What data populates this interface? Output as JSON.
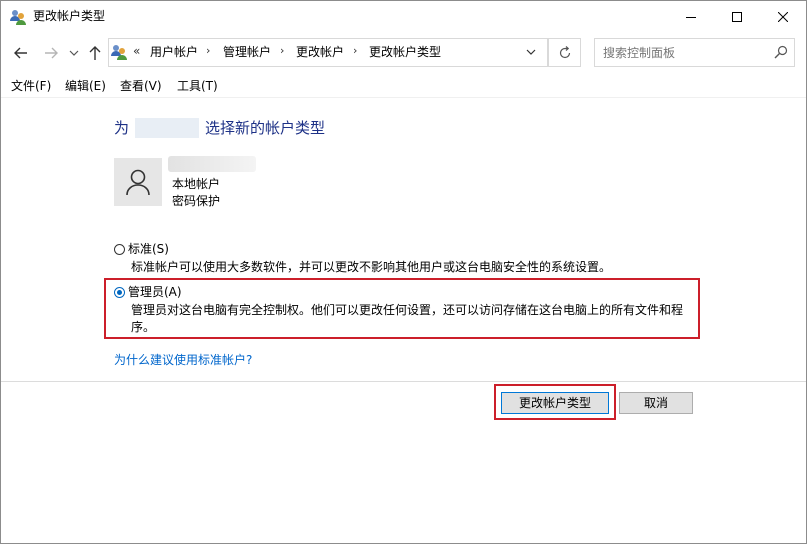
{
  "window": {
    "title": "更改帐户类型"
  },
  "address_bar": {
    "overflow": "«",
    "breadcrumbs": [
      "用户帐户",
      "管理帐户",
      "更改帐户",
      "更改帐户类型"
    ]
  },
  "search": {
    "placeholder": "搜索控制面板"
  },
  "menu": {
    "items": [
      "文件(F)",
      "编辑(E)",
      "查看(V)",
      "工具(T)"
    ]
  },
  "main": {
    "heading_prefix": "为",
    "heading_suffix": "选择新的帐户类型",
    "account": {
      "type": "本地帐户",
      "protection": "密码保护"
    },
    "options": [
      {
        "label": "标准(S)",
        "description": "标准帐户可以使用大多数软件，并可以更改不影响其他用户或这台电脑安全性的系统设置。",
        "checked": false
      },
      {
        "label": "管理员(A)",
        "description_line1": "管理员对这台电脑有完全控制权。他们可以更改任何设置，还可以访问存储在这台电脑上的所有文件和程",
        "description_line2": "序。",
        "checked": true
      }
    ],
    "help_link": "为什么建议使用标准帐户?"
  },
  "buttons": {
    "confirm": "更改帐户类型",
    "cancel": "取消"
  },
  "colors": {
    "heading": "#1e3287",
    "link": "#0066cc",
    "highlight": "#cc1f2a",
    "radio_selected": "#0067c0"
  }
}
